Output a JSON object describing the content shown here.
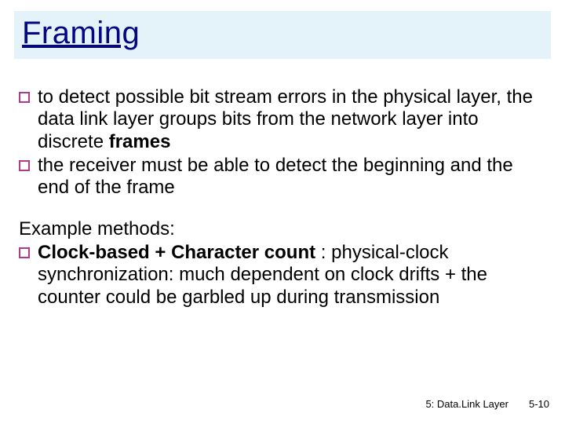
{
  "title": "Framing",
  "bullets": [
    {
      "pre": "to detect possible bit stream errors in the physical layer, the data link layer groups bits from the network layer into discrete ",
      "bold": "frames",
      "post": ""
    },
    {
      "pre": "the receiver must be able to detect the beginning and the end of the frame",
      "bold": "",
      "post": ""
    }
  ],
  "example_heading": "Example methods:",
  "example_bullet": {
    "bold": "Clock-based + Character count",
    "sep": " : ",
    "rest": "physical-clock synchronization: much dependent on clock drifts + the counter could be garbled up during transmission"
  },
  "footer": {
    "section": "5: Data.Link Layer",
    "page": "5-10"
  }
}
